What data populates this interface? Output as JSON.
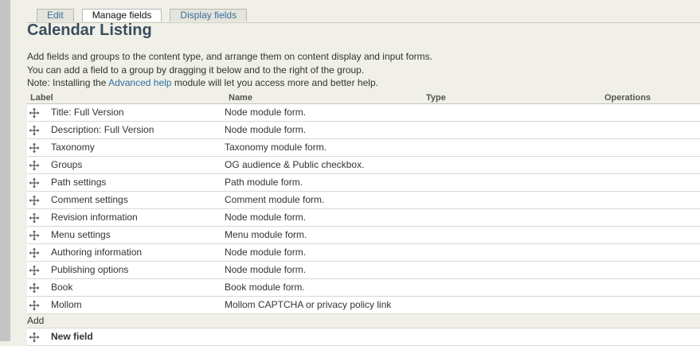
{
  "tabs": [
    {
      "label": "Edit",
      "active": false
    },
    {
      "label": "Manage fields",
      "active": true
    },
    {
      "label": "Display fields",
      "active": false
    }
  ],
  "page_title": "Calendar Listing",
  "intro": {
    "line1": "Add fields and groups to the content type, and arrange them on content display and input forms.",
    "line2": "You can add a field to a group by dragging it below and to the right of the group.",
    "line3_before": "Note: Installing the ",
    "line3_link": "Advanced help",
    "line3_after": " module will let you access more and better help."
  },
  "table": {
    "headers": {
      "label": "Label",
      "name": "Name",
      "type": "Type",
      "operations": "Operations"
    },
    "rows": [
      {
        "label": "Title: Full Version",
        "name": "Node module form."
      },
      {
        "label": "Description: Full Version",
        "name": "Node module form."
      },
      {
        "label": "Taxonomy",
        "name": "Taxonomy module form."
      },
      {
        "label": "Groups",
        "name": "OG audience & Public checkbox."
      },
      {
        "label": "Path settings",
        "name": "Path module form."
      },
      {
        "label": "Comment settings",
        "name": "Comment module form."
      },
      {
        "label": "Revision information",
        "name": "Node module form."
      },
      {
        "label": "Menu settings",
        "name": "Menu module form."
      },
      {
        "label": "Authoring information",
        "name": "Node module form."
      },
      {
        "label": "Publishing options",
        "name": "Node module form."
      },
      {
        "label": "Book",
        "name": "Book module form."
      },
      {
        "label": "Mollom",
        "name": "Mollom CAPTCHA or privacy policy link"
      }
    ],
    "add_label": "Add",
    "new_field_label": "New field"
  },
  "icons": {
    "drag": "move-arrows-icon"
  },
  "colors": {
    "link": "#2f6da3",
    "title": "#3a4e5e",
    "background": "#f0f0e8"
  }
}
